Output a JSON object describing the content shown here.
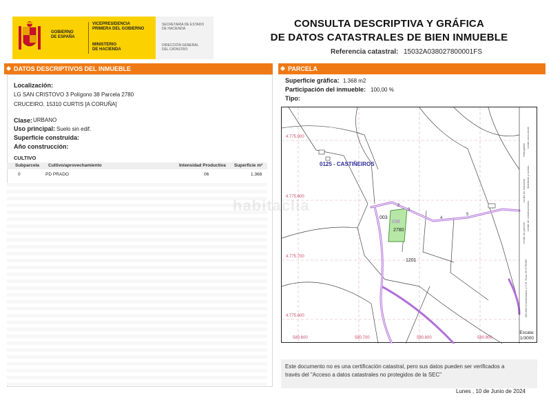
{
  "header": {
    "ministry_block1": "Gobierno\nde España",
    "ministry_block2": "Vicepresidencia\nprimera del gobierno",
    "ministry_block3": "Ministerio\nde Hacienda",
    "secretaria": "Secretaría de Estado\nde Hacienda",
    "direccion": "Dirección General\ndel Catastro",
    "title_line1": "CONSULTA DESCRIPTIVA Y GRÁFICA",
    "title_line2": "DE DATOS CATASTRALES DE BIEN INMUEBLE",
    "ref_label": "Referencia catastral:",
    "ref_value": "15032A038027800001FS"
  },
  "left_panel": {
    "title": "DATOS DESCRIPTIVOS DEL INMUEBLE",
    "localizacion_label": "Localización:",
    "localizacion_line1": "LG SAN CRISTOVO 3 Polígono 38 Parcela 2780",
    "localizacion_line2": "CRUCEIRO. 15310 CURTIS [A CORUÑA]",
    "clase_label": "Clase:",
    "clase_value": "URBANO",
    "uso_label": "Uso principal:",
    "uso_value": "Suelo sin edif.",
    "superficie_label": "Superficie construida:",
    "ano_label": "Año construcción:",
    "cultivo_title": "CULTIVO",
    "table_headers": {
      "subparcela": "Subparcela",
      "cultivo": "Cultivo/aprovechamiento",
      "intensidad": "Intensidad Productiva",
      "superficie": "Superficie m²"
    },
    "table_rows": [
      {
        "subparcela": "0",
        "cultivo": "PD PRADO",
        "intensidad": "06",
        "superficie": "1.368"
      }
    ]
  },
  "right_panel": {
    "title": "PARCELA",
    "superficie_label": "Superficie gráfica:",
    "superficie_value": "1.368 m2",
    "participacion_label": "Participación del inmueble:",
    "participacion_value": "100,00 %",
    "tipo_label": "Tipo:"
  },
  "map": {
    "place_name": "0125 - CASTIÑEIROS",
    "parcel_label": "038",
    "parcel_number": "2780",
    "label_003": "003",
    "label_1201": "1201",
    "y_labels": [
      "4.775.900",
      "4.775.800",
      "4.775.700",
      "4.775.600"
    ],
    "x_labels": [
      "580.600",
      "580.700",
      "580.800",
      "580.900"
    ],
    "road_numbers": [
      "2",
      "3",
      "4",
      "5",
      "7"
    ],
    "legend_title": "Leyenda",
    "legend_items": [
      "Límite de parcela",
      "Mobiliario y aceras",
      "Límite de construcciones",
      "Límite zona verde",
      "Límite de manzana",
      "Hidrografía"
    ],
    "coordinate_note": "580.800 Coordenadas U.T.M. Huso 29 ETRS89",
    "scale_label": "Escala:",
    "scale_value": "1/3000",
    "parcel_color": "#b7e7a6",
    "road_color": "#b070d8",
    "grid_color": "#e3a3b3"
  },
  "footer": {
    "notice_line1": "Este documento no es una certificación catastral, pero sus datos pueden ser verificados a",
    "notice_line2": "través del \"Acceso a datos catastrales no protegidos de la SEC\"",
    "date": "Lunes , 10 de Junio de 2024",
    "watermark": "habitaclia"
  },
  "colors": {
    "accent": "#ef7a15",
    "brand_yellow": "#fbd200"
  }
}
